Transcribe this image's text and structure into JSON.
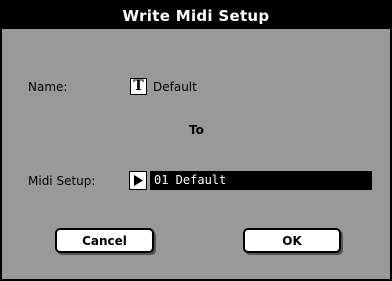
{
  "dialog": {
    "title": "Write Midi Setup",
    "name_label": "Name:",
    "name_icon_glyph": "T",
    "name_icon": "text-edit-icon",
    "name_value": "Default",
    "to_label": "To",
    "midi_setup_label": "Midi Setup:",
    "midi_setup_icon": "play-arrow-icon",
    "midi_setup_value": "01 Default",
    "cancel_label": "Cancel",
    "ok_label": "OK"
  },
  "colors": {
    "background": "#999999",
    "title_bar": "#000000",
    "title_text": "#ffffff",
    "field_selected": "#000000"
  }
}
